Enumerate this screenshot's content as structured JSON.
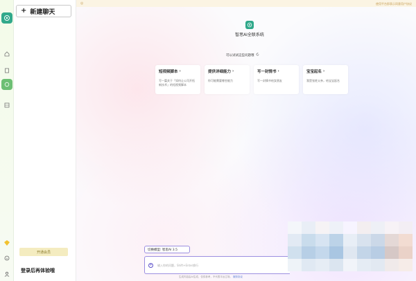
{
  "sidebar": {
    "new_chat_label": "新建聊天",
    "upgrade_label": "开通会员",
    "login_text": "登录后再体验哦"
  },
  "topbar": {
    "notice": "使用平台即表示同意用户协议"
  },
  "brand": {
    "title": "智思AI全联系统"
  },
  "suggest": {
    "label": "可以试试这些问题哦"
  },
  "cards": [
    {
      "title": "短视频脚本",
      "desc": "写一篇关于「如何让公司开拓新技术」的短视频脚本"
    },
    {
      "title": "提供详细能力",
      "desc": "你可能需要哪些能力"
    },
    {
      "title": "写一封情书",
      "desc": "写一封情书给女朋友"
    },
    {
      "title": "宝宝起名",
      "desc": "我是张姓父亲，给宝宝起名"
    }
  ],
  "model": {
    "label": "切换模型: 智思AI 3.5"
  },
  "input": {
    "placeholder": "输入你的问题，Shift+Enter换行"
  },
  "footer": {
    "disclaimer": "生成内容由AI生成，仅供参考，不代表平台立场。",
    "link": "服务协议"
  },
  "colors": {
    "brand": "#31a98b",
    "accent": "#9b8ee0",
    "upgrade_bg": "#f4ecc0",
    "notice_bg": "#fbf4e3"
  },
  "icons": {
    "rail": [
      "logo-icon",
      "home-icon",
      "document-icon",
      "chat-icon",
      "library-icon",
      "vip-icon",
      "info-icon",
      "user-icon"
    ],
    "refresh": "refresh-icon",
    "chevron": "chevron-right-icon"
  }
}
